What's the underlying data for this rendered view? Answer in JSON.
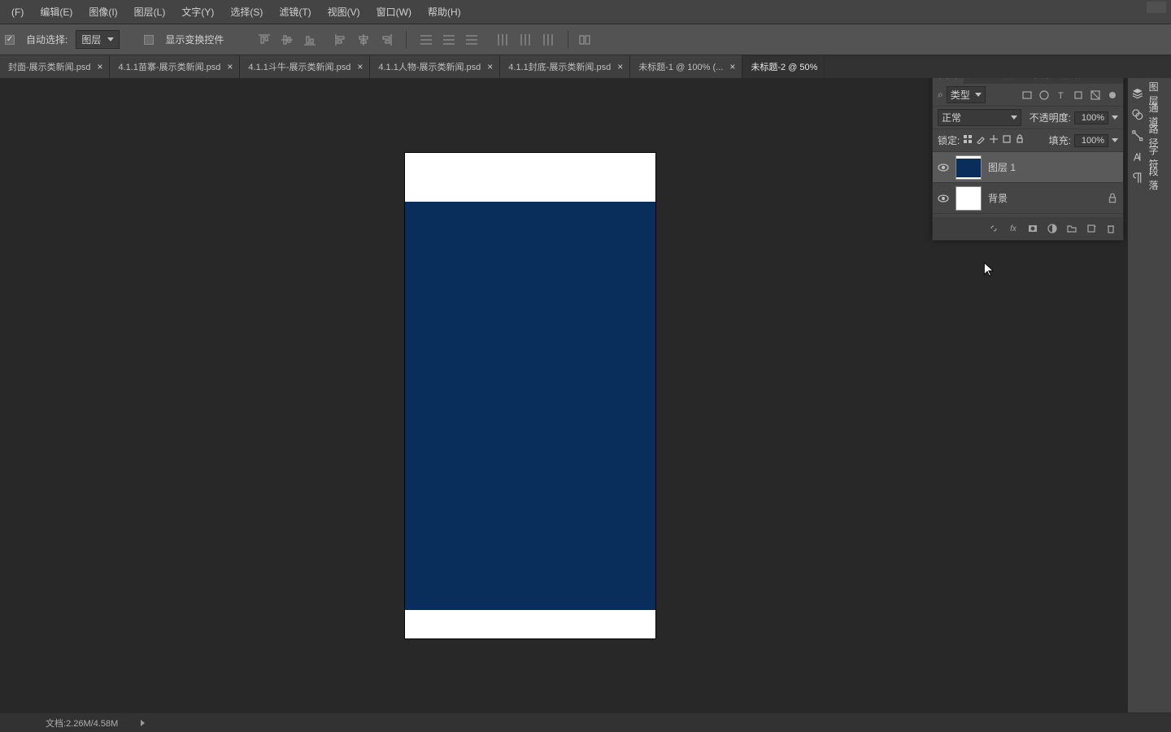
{
  "menubar": {
    "file": "(F)",
    "edit": "编辑(E)",
    "image": "图像(I)",
    "layer": "图层(L)",
    "type": "文字(Y)",
    "select": "选择(S)",
    "filter": "滤镜(T)",
    "view": "视图(V)",
    "window": "窗口(W)",
    "help": "帮助(H)"
  },
  "options": {
    "auto_select": "自动选择:",
    "auto_select_target": "图层",
    "show_transform": "显示变换控件"
  },
  "tabs": [
    {
      "label": "封面-展示类新闻.psd",
      "active": false
    },
    {
      "label": "4.1.1苗寨-展示类新闻.psd",
      "active": false
    },
    {
      "label": "4.1.1斗牛-展示类新闻.psd",
      "active": false
    },
    {
      "label": "4.1.1人物-展示类新闻.psd",
      "active": false
    },
    {
      "label": "4.1.1封底-展示类新闻.psd",
      "active": false
    },
    {
      "label": "未标题-1 @ 100% (...",
      "active": false
    },
    {
      "label": "未标题-2 @ 50%",
      "active": true
    }
  ],
  "panel": {
    "tabs": {
      "layers": "图层",
      "channels": "通道",
      "paths": "路径",
      "character": "字符",
      "paragraph": "段落"
    },
    "filter_label": "类型",
    "blend_mode": "正常",
    "opacity_label": "不透明度:",
    "opacity_value": "100%",
    "lock_label": "锁定:",
    "fill_label": "填充:",
    "fill_value": "100%"
  },
  "layers": [
    {
      "name": "图层 1",
      "selected": true,
      "thumb": "navy",
      "locked": false
    },
    {
      "name": "背景",
      "selected": false,
      "thumb": "white",
      "locked": true
    }
  ],
  "dock": {
    "layers": "图层",
    "channels": "通道",
    "paths": "路径",
    "character": "字符",
    "paragraph": "段落"
  },
  "status": {
    "doc_label": "文档:",
    "doc_size": "2.26M/4.58M"
  }
}
